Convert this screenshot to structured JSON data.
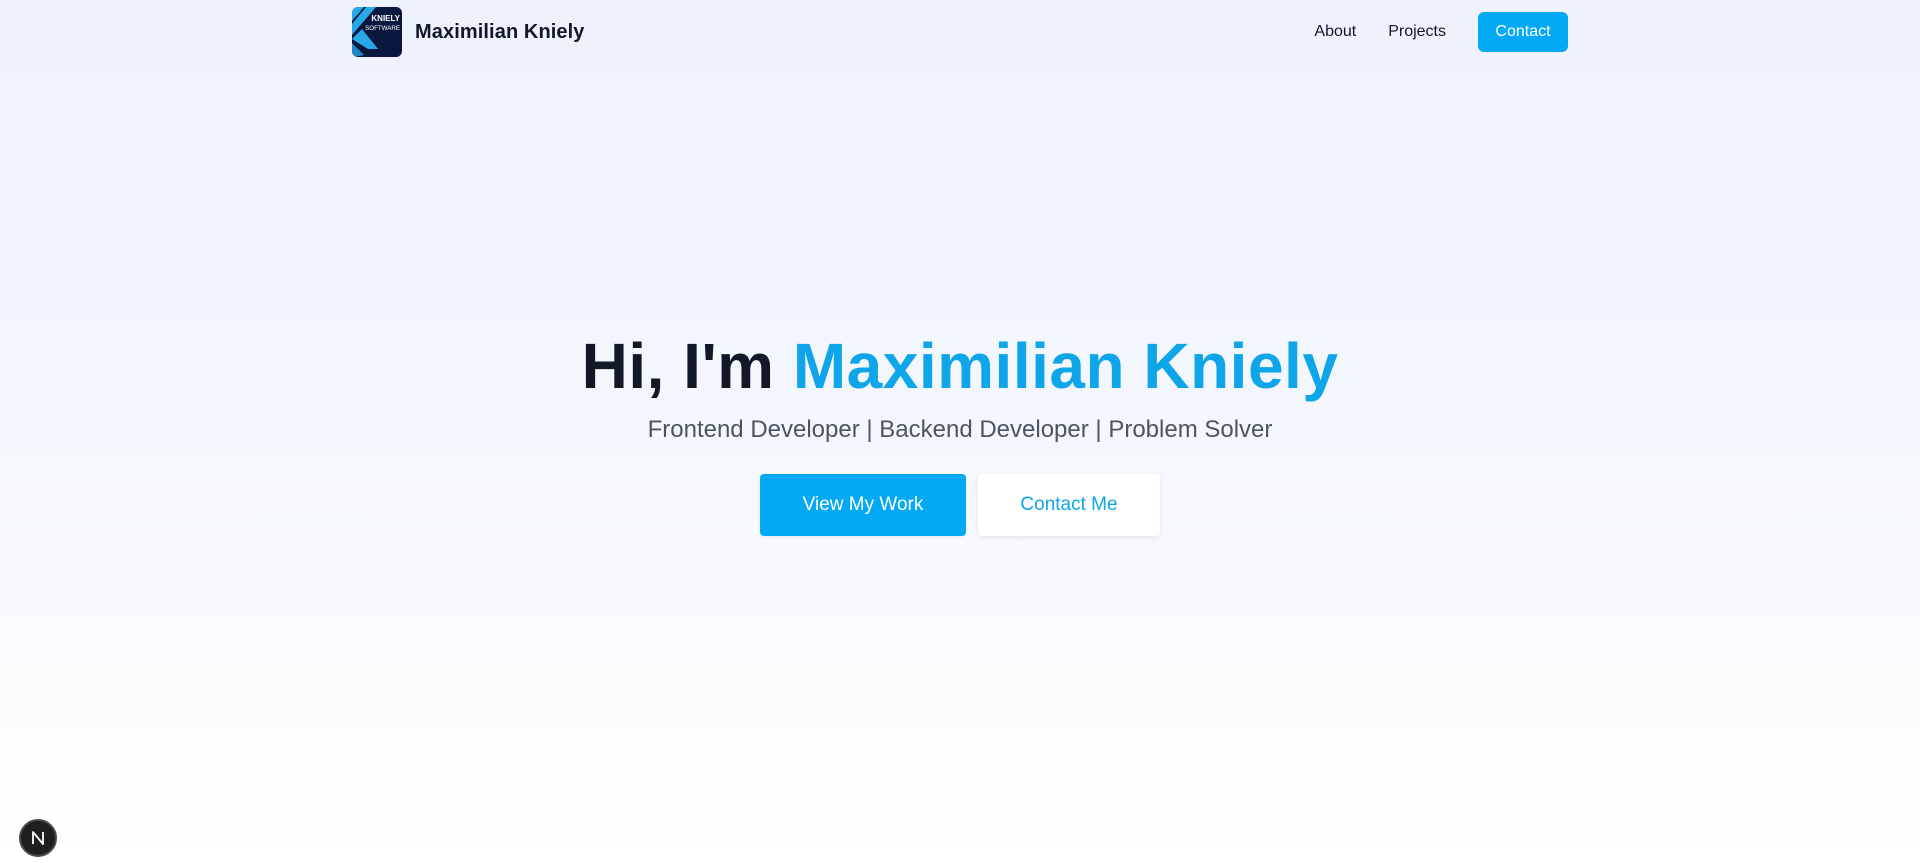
{
  "navbar": {
    "logo": {
      "line1": "KNIELY",
      "line2": "SOFTWARE",
      "background": "#0a1840",
      "accent": "#29a8e8"
    },
    "brand_name": "Maximilian Kniely",
    "links": {
      "about": "About",
      "projects": "Projects",
      "contact": "Contact"
    }
  },
  "hero": {
    "title_prefix": "Hi, I'm ",
    "title_name": "Maximilian Kniely",
    "subtitle": "Frontend Developer | Backend Developer | Problem Solver",
    "primary_button": "View My Work",
    "secondary_button": "Contact Me"
  },
  "dev_indicator": {
    "icon": "nextjs-n-icon",
    "letter": "N"
  },
  "colors": {
    "accent": "#03a9f4",
    "accent_text": "#0ea5e9",
    "heading": "#111827",
    "subtitle": "#4b5563"
  }
}
